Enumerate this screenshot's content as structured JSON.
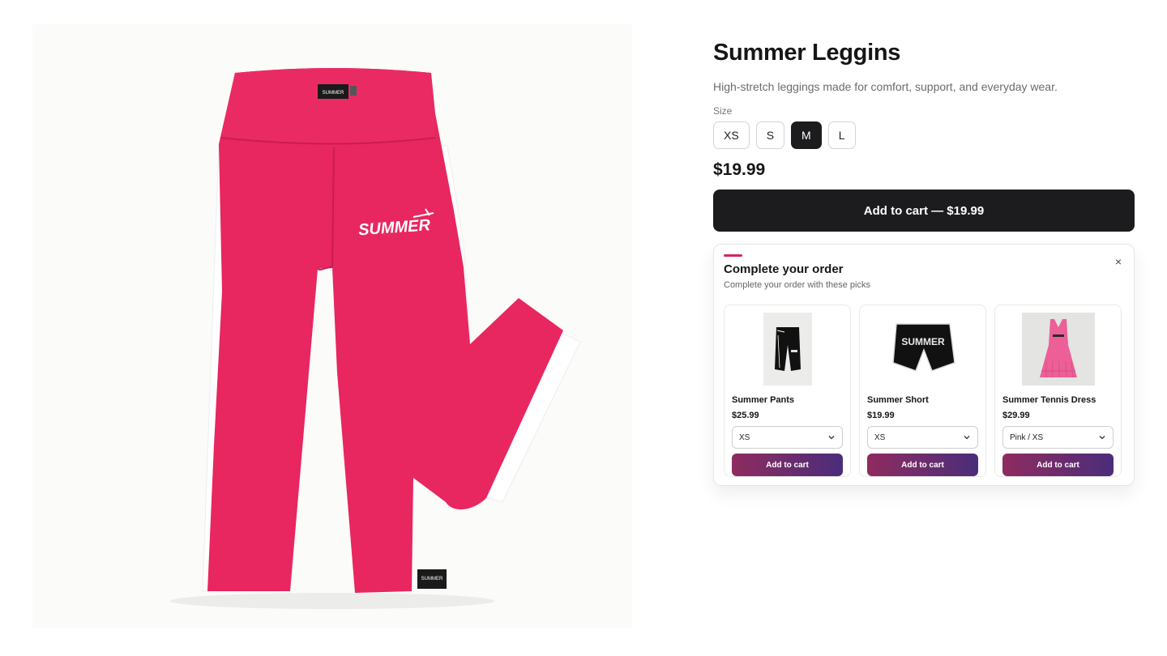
{
  "product": {
    "title": "Summer Leggins",
    "description": "High-stretch leggings made for comfort, support, and everyday wear.",
    "size_label": "Size",
    "sizes": [
      "XS",
      "S",
      "M",
      "L"
    ],
    "selected_size": "M",
    "price": "$19.99",
    "add_to_cart_label": "Add to cart — $19.99",
    "image": {
      "subject": "pink leggings with white side stripes",
      "print": "SUMMER",
      "tag": "SUMMER",
      "colors": {
        "main": "#e8265f",
        "stripe": "#ffffff"
      }
    }
  },
  "upsell": {
    "title": "Complete your order",
    "subtitle": "Complete your order with these picks",
    "close_icon": "×",
    "accent_color": "#d6245c",
    "items": [
      {
        "name": "Summer Pants",
        "price": "$25.99",
        "option": "XS",
        "button": "Add to cart",
        "thumbnail": "black-pants"
      },
      {
        "name": "Summer Short",
        "price": "$19.99",
        "option": "XS",
        "button": "Add to cart",
        "thumbnail": "black-shorts",
        "print": "SUMMER"
      },
      {
        "name": "Summer Tennis Dress",
        "price": "$29.99",
        "option": "Pink / XS",
        "button": "Add to cart",
        "thumbnail": "pink-dress"
      }
    ]
  },
  "colors": {
    "dark": "#1c1c1e",
    "gradient_start": "#8f2b5f",
    "gradient_end": "#4a2d7a"
  }
}
